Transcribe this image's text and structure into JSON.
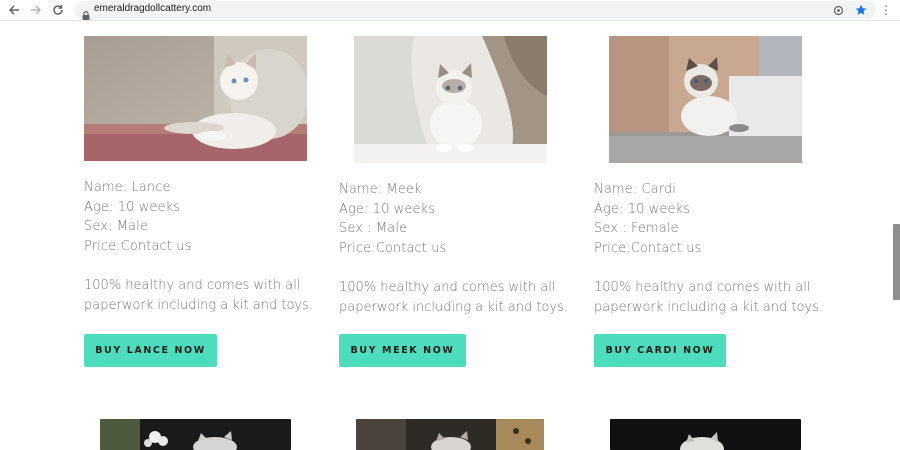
{
  "browser": {
    "url": "emeraldragdollcattery.com"
  },
  "cards": [
    {
      "name_line": "Name: Lance",
      "age_line": "Age: 10 weeks",
      "sex_line": "Sex: Male",
      "price_line": "Price:Contact us",
      "description": "100% healthy and comes with all paperwork including a kit and toys.",
      "button_label": "BUY LANCE NOW"
    },
    {
      "name_line": "Name: Meek",
      "age_line": "Age: 10 weeks",
      "sex_line": "Sex : Male",
      "price_line": "Price:Contact us",
      "description": "100% healthy and comes with all paperwork including a kit and toys.",
      "button_label": "BUY MEEK NOW"
    },
    {
      "name_line": "Name: Cardi",
      "age_line": "Age: 10 weeks",
      "sex_line": "Sex : Female",
      "price_line": "Price:Contact us",
      "description": "100% healthy and comes with all paperwork including a kit and toys.",
      "button_label": "BUY CARDI NOW"
    }
  ],
  "colors": {
    "button_bg": "#4dddbd",
    "text": "#777777",
    "star": "#1a73e8"
  },
  "icons": [
    "back-arrow-icon",
    "forward-arrow-icon",
    "reload-icon",
    "lock-icon",
    "zoom-icon",
    "bookmark-star-icon",
    "menu-dots-icon"
  ]
}
